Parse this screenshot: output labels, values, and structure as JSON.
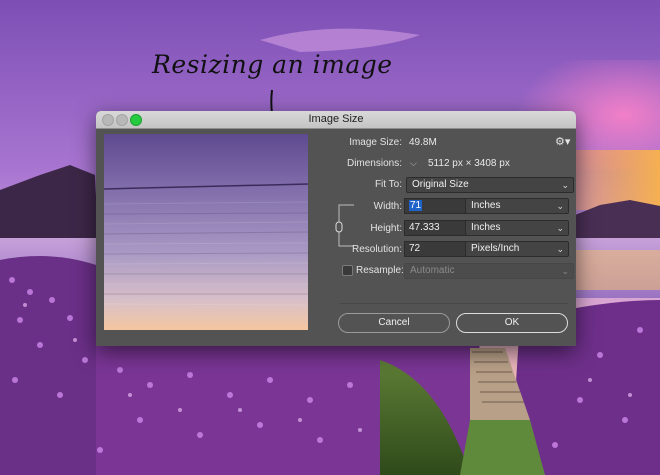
{
  "annotation": {
    "text": "Resizing an image"
  },
  "dialog": {
    "title": "Image Size",
    "image_size": {
      "label": "Image Size:",
      "value": "49.8M"
    },
    "dimensions": {
      "label": "Dimensions:",
      "width": "5112 px",
      "separator": "×",
      "height": "3408 px"
    },
    "fit_to": {
      "label": "Fit To:",
      "value": "Original Size"
    },
    "width": {
      "label": "Width:",
      "value": "71",
      "unit": "Inches"
    },
    "height": {
      "label": "Height:",
      "value": "47.333",
      "unit": "Inches"
    },
    "resolution": {
      "label": "Resolution:",
      "value": "72",
      "unit": "Pixels/Inch"
    },
    "resample": {
      "label": "Resample:",
      "value": "Automatic",
      "checked": false
    },
    "buttons": {
      "cancel": "Cancel",
      "ok": "OK"
    }
  },
  "icons": {
    "gear": "gear-icon",
    "chevron": "chevron-down-icon",
    "link": "chain-link-icon",
    "close": "close-icon",
    "minimize": "minimize-icon",
    "zoom": "zoom-icon"
  },
  "colors": {
    "dialog_bg": "#535353",
    "field_bg": "#3a3a3a",
    "selection": "#1f62c8",
    "zoom_button": "#27c93f"
  }
}
